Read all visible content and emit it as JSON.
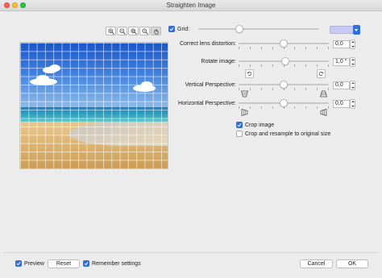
{
  "window": {
    "title": "Straighten Image"
  },
  "toolbar": {
    "zoom_icons": [
      "zoom-in-icon",
      "zoom-out-icon",
      "zoom-fit-icon",
      "zoom-actual-icon",
      "hand-pan-icon"
    ]
  },
  "grid": {
    "label": "Grid:",
    "checked": true,
    "slider_value": 0.34,
    "color": "#c9c9f6"
  },
  "lens_distortion": {
    "label": "Correct lens distortion:",
    "value": "0,0",
    "slider_value": 0.5
  },
  "rotate": {
    "label": "Rotate image:",
    "value": "1,0 °",
    "slider_value": 0.52
  },
  "vertical_perspective": {
    "label": "Vertical Perspective:",
    "value": "0,0",
    "slider_value": 0.5
  },
  "horizontal_perspective": {
    "label": "Horizontal Perspective:",
    "value": "0,0",
    "slider_value": 0.5
  },
  "crop_image": {
    "label": "Crop image",
    "checked": true
  },
  "crop_resample": {
    "label": "Crop and resample to original size",
    "checked": false
  },
  "footer": {
    "preview_label": "Preview",
    "reset_label": "Reset",
    "remember_label": "Remember settings",
    "cancel_label": "Cancel",
    "ok_label": "OK"
  },
  "colors": {
    "accent": "#2f6fe0"
  }
}
